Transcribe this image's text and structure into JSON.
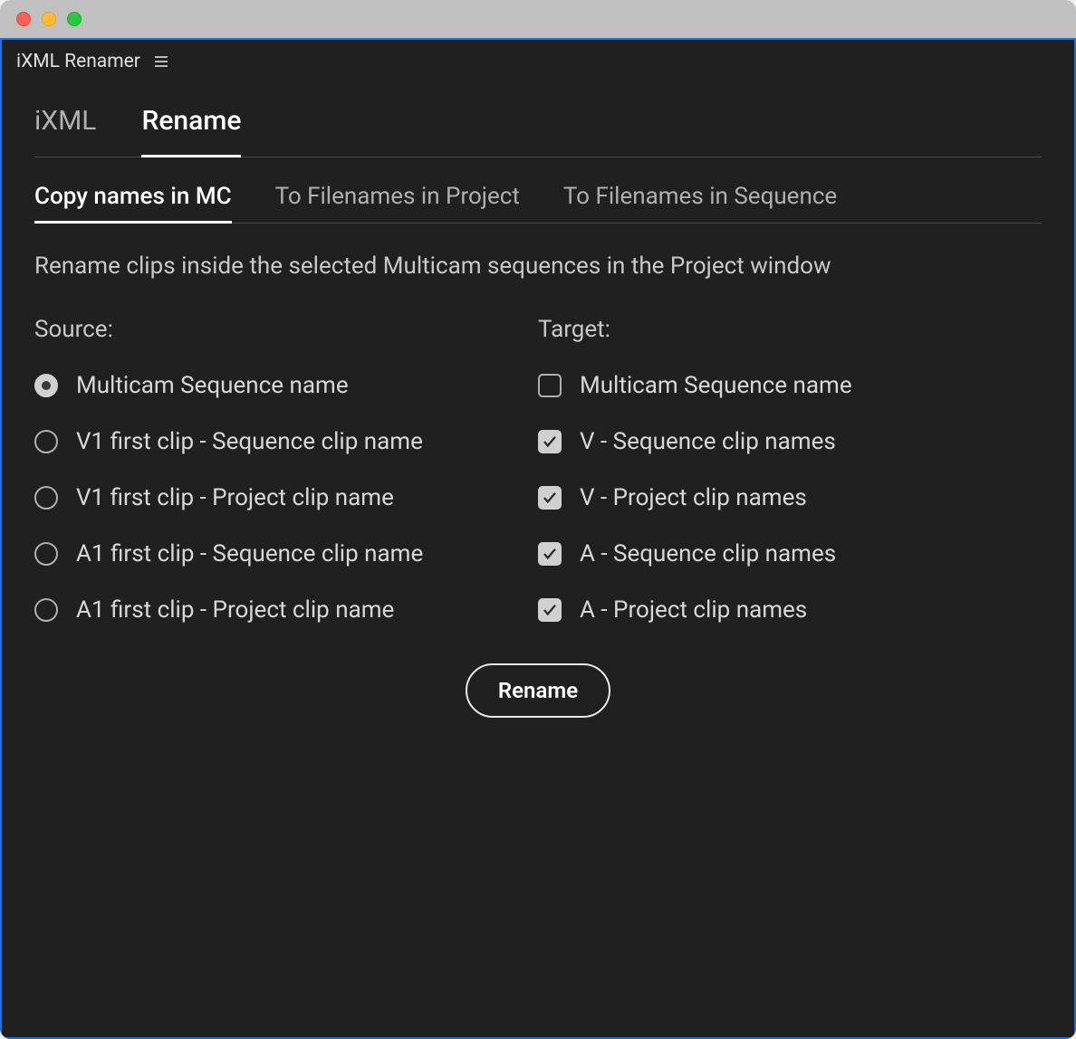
{
  "window": {
    "title": "iXML Renamer"
  },
  "primary_tabs": [
    {
      "id": "ixml",
      "label": "iXML",
      "active": false
    },
    {
      "id": "rename",
      "label": "Rename",
      "active": true
    }
  ],
  "secondary_tabs": [
    {
      "id": "copy-mc",
      "label": "Copy names in MC",
      "active": true
    },
    {
      "id": "to-project",
      "label": "To Filenames in Project",
      "active": false
    },
    {
      "id": "to-sequence",
      "label": "To Filenames in Sequence",
      "active": false
    }
  ],
  "description": "Rename clips inside the selected Multicam sequences in the Project window",
  "source": {
    "header": "Source:",
    "options": [
      {
        "id": "mc-seq-name",
        "label": "Multicam Sequence name",
        "selected": true
      },
      {
        "id": "v1-seq-clip",
        "label": "V1 first clip - Sequence clip name",
        "selected": false
      },
      {
        "id": "v1-proj-clip",
        "label": "V1 first clip - Project clip name",
        "selected": false
      },
      {
        "id": "a1-seq-clip",
        "label": "A1 first clip - Sequence clip name",
        "selected": false
      },
      {
        "id": "a1-proj-clip",
        "label": "A1 first clip - Project clip name",
        "selected": false
      }
    ]
  },
  "target": {
    "header": "Target:",
    "options": [
      {
        "id": "t-mc-seq-name",
        "label": "Multicam Sequence name",
        "checked": false
      },
      {
        "id": "t-v-seq",
        "label": "V - Sequence clip names",
        "checked": true
      },
      {
        "id": "t-v-proj",
        "label": "V - Project clip names",
        "checked": true
      },
      {
        "id": "t-a-seq",
        "label": "A - Sequence clip names",
        "checked": true
      },
      {
        "id": "t-a-proj",
        "label": "A - Project clip names",
        "checked": true
      }
    ]
  },
  "action": {
    "rename_label": "Rename"
  }
}
